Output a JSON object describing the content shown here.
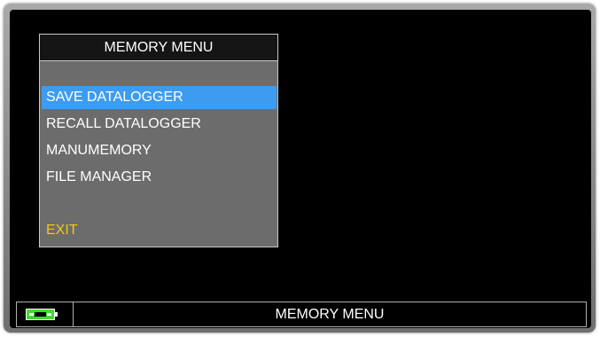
{
  "menu": {
    "title": "MEMORY MENU",
    "items": [
      {
        "label": "SAVE DATALOGGER",
        "selected": true
      },
      {
        "label": "RECALL DATALOGGER",
        "selected": false
      },
      {
        "label": "MANUMEMORY",
        "selected": false
      },
      {
        "label": "FILE MANAGER",
        "selected": false
      }
    ],
    "exit_label": "EXIT"
  },
  "status_bar": {
    "battery_icon": "battery-charging-icon",
    "title": "MEMORY MENU"
  },
  "colors": {
    "selection": "#3e9cf0",
    "exit": "#f2c811",
    "panel": "#6c6c6c",
    "battery": "#3ddc2a"
  }
}
